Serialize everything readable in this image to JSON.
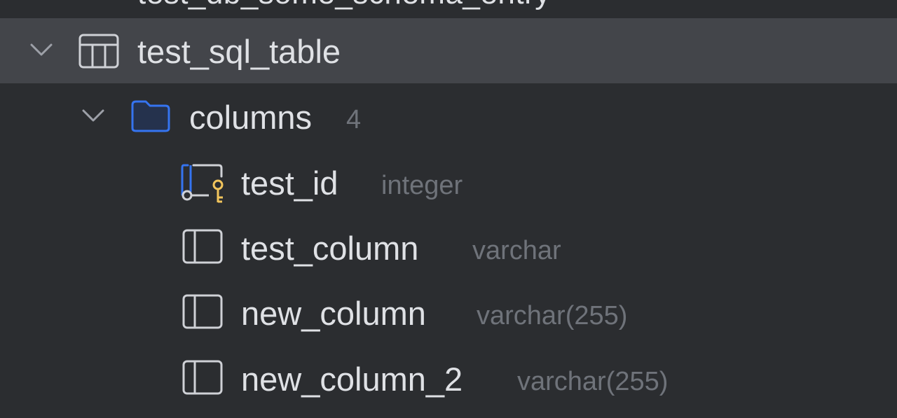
{
  "tree": {
    "clipped_item": {
      "label": "test_db_some_schema_entry"
    },
    "table": {
      "label": "test_sql_table",
      "expanded": true,
      "icon": "table-icon"
    },
    "columns_folder": {
      "label": "columns",
      "count": "4",
      "expanded": true,
      "icon": "folder-icon"
    },
    "columns": [
      {
        "name": "test_id",
        "type": "integer",
        "icon": "primary-key-column-icon"
      },
      {
        "name": "test_column",
        "type": "varchar",
        "icon": "column-icon"
      },
      {
        "name": "new_column",
        "type": "varchar(255)",
        "icon": "column-icon"
      },
      {
        "name": "new_column_2",
        "type": "varchar(255)",
        "icon": "column-icon"
      }
    ]
  },
  "colors": {
    "background": "#2b2d30",
    "selected_row": "#43454a",
    "text": "#dfe1e5",
    "muted_text": "#6f737a",
    "folder_blue": "#3574f0",
    "key_yellow": "#f2c55c"
  }
}
